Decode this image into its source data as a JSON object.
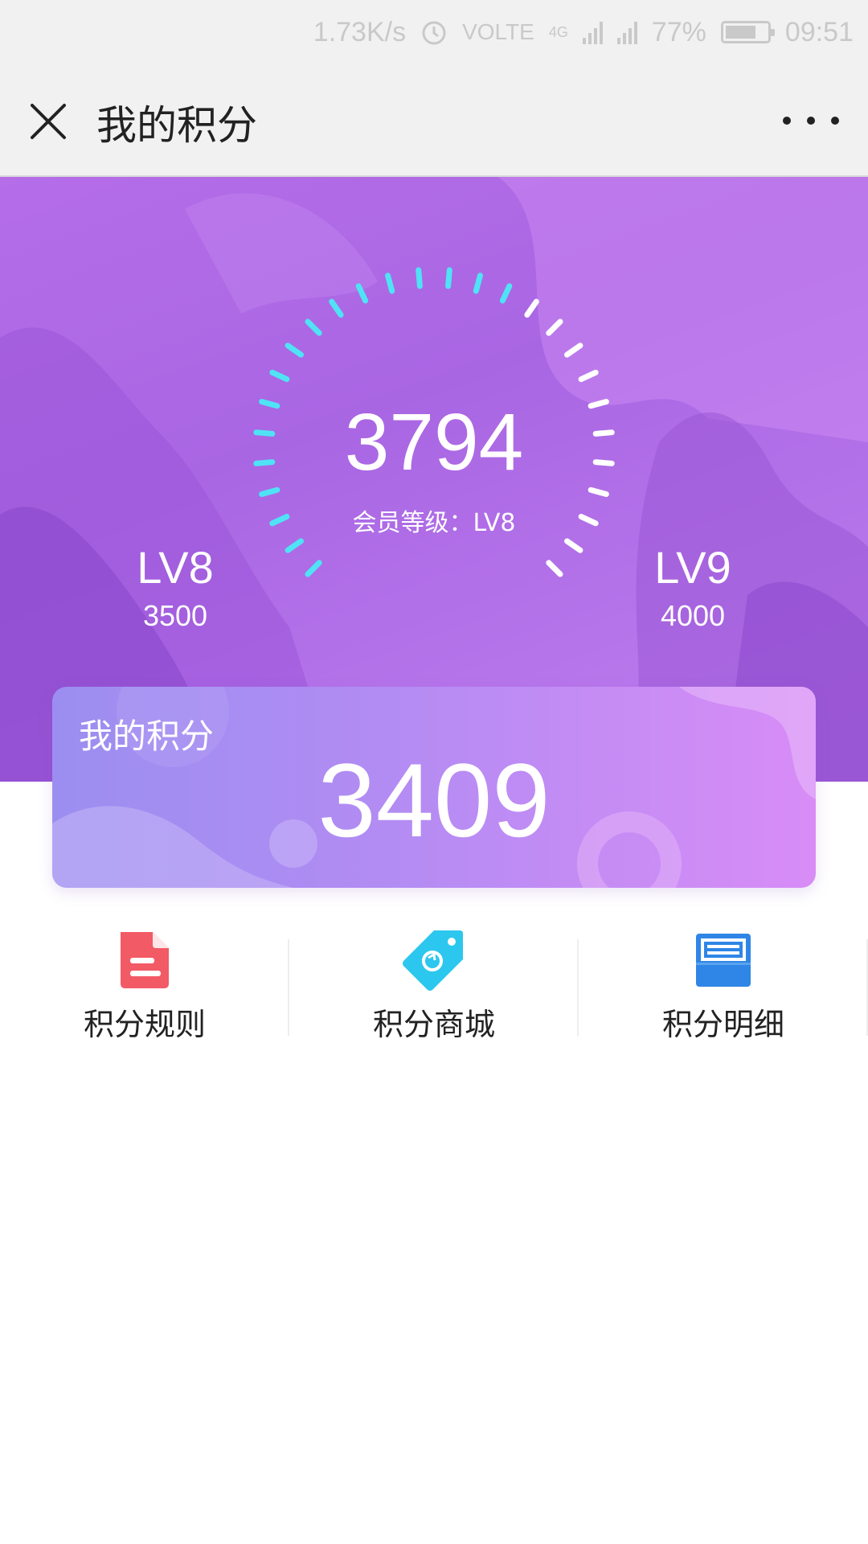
{
  "status_bar": {
    "net_speed": "1.73K/s",
    "volte": "VOLTE",
    "network": "4G",
    "battery": "77%",
    "time": "09:51"
  },
  "nav": {
    "title": "我的积分"
  },
  "gauge": {
    "points": "3794",
    "level_label": "会员等级：LV8",
    "progress": 0.588,
    "left_level": {
      "name": "LV8",
      "points": "3500"
    },
    "right_level": {
      "name": "LV9",
      "points": "4000"
    },
    "active_color": "#4fe3f5",
    "inactive_color": "#ffffff"
  },
  "card": {
    "label": "我的积分",
    "points": "3409"
  },
  "actions": [
    {
      "label": "积分规则",
      "icon": "document-icon",
      "color": "#f25a66"
    },
    {
      "label": "积分商城",
      "icon": "tag-icon",
      "color": "#2cc7ee"
    },
    {
      "label": "积分明细",
      "icon": "list-icon",
      "color": "#2f86e6"
    }
  ]
}
